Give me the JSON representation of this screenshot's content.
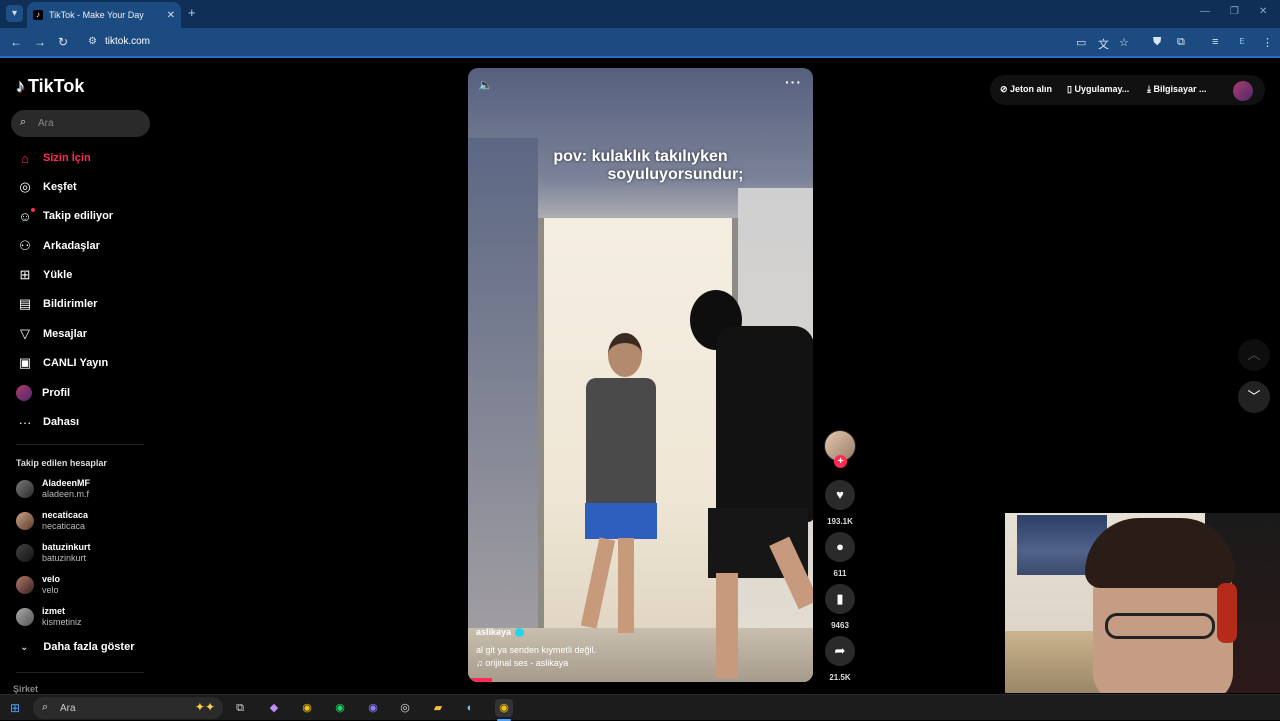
{
  "browser": {
    "tab_title": "TikTok - Make Your Day",
    "url": "tiktok.com",
    "profile_initial": "E"
  },
  "sidebar": {
    "logo": "TikTok",
    "search_placeholder": "Ara",
    "menu": [
      {
        "label": "Sizin İçin",
        "icon": "home-icon"
      },
      {
        "label": "Keşfet",
        "icon": "compass-icon"
      },
      {
        "label": "Takip ediliyor",
        "icon": "person-check-icon"
      },
      {
        "label": "Arkadaşlar",
        "icon": "friends-icon"
      },
      {
        "label": "Yükle",
        "icon": "plus-square-icon"
      },
      {
        "label": "Bildirimler",
        "icon": "inbox-icon"
      },
      {
        "label": "Mesajlar",
        "icon": "paper-plane-icon"
      },
      {
        "label": "CANLI Yayın",
        "icon": "live-tv-icon"
      },
      {
        "label": "Profil",
        "icon": "avatar-icon"
      },
      {
        "label": "Dahası",
        "icon": "more-icon"
      }
    ],
    "following_header": "Takip edilen hesaplar",
    "accounts": [
      {
        "name": "AladeenMF",
        "handle": "aladeen.m.f"
      },
      {
        "name": "necaticaca",
        "handle": "necaticaca"
      },
      {
        "name": "batuzinkurt",
        "handle": "batuzinkurt"
      },
      {
        "name": "velo",
        "handle": "velo"
      },
      {
        "name": "izmet",
        "handle": "kismetiniz"
      }
    ],
    "show_more": "Daha fazla göster",
    "footer_company": "Şirket"
  },
  "video": {
    "caption_line1": "pov: kulaklık takılıyken",
    "caption_line2": "soyuluyorsundur;",
    "username": "aslikaya",
    "description": "al git ya senden kıymetli değil.",
    "music": "orijinal ses - aslikaya",
    "progress_fraction": 0.07
  },
  "actions": {
    "likes": "193.1K",
    "comments": "611",
    "saves": "9463",
    "shares": "21.5K"
  },
  "topbar": {
    "coins": "Jeton alın",
    "app": "Uygulamay...",
    "desktop": "Bilgisayar ..."
  },
  "taskbar": {
    "search": "Ara"
  },
  "colors": {
    "accent": "#fe2c55",
    "browser_frame": "#1b4b80",
    "verified": "#20d5ec"
  }
}
